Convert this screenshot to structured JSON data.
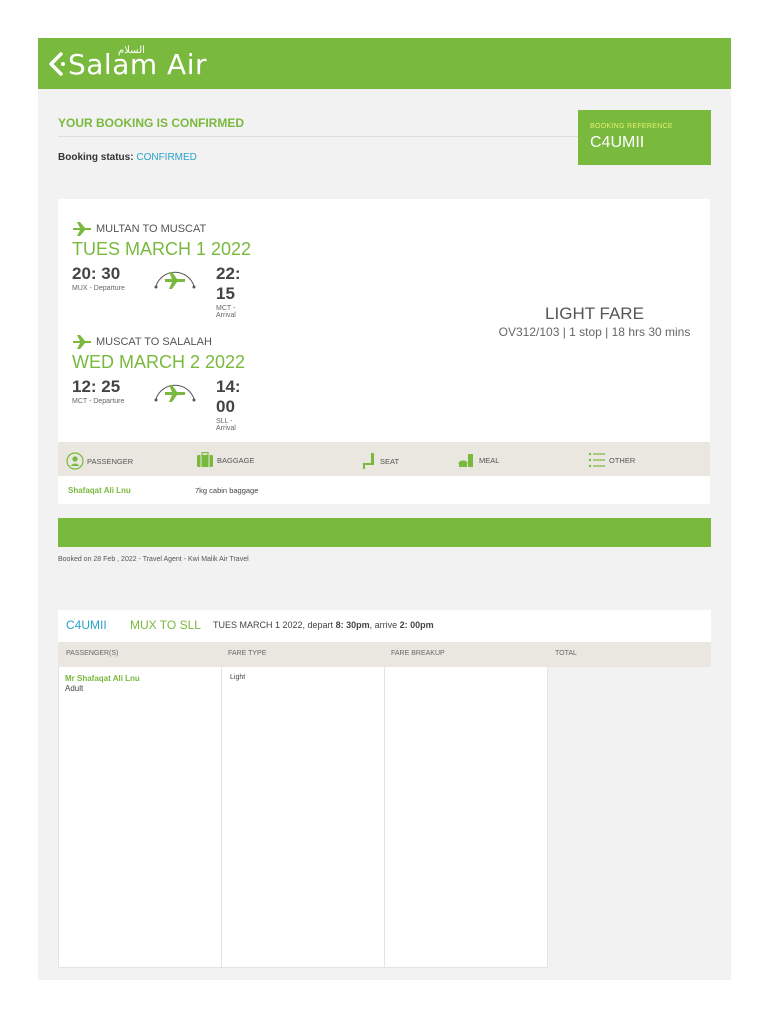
{
  "header": {
    "logo_text": "Salam Air",
    "logo_arabic": "السلام"
  },
  "confirmation": {
    "title": "YOUR BOOKING IS CONFIRMED",
    "status_label": "Booking status:",
    "status_value": "CONFIRMED"
  },
  "reference": {
    "label": "BOOKING REFERENCE",
    "value": "C4UMII"
  },
  "segments": [
    {
      "route": "MULTAN TO MUSCAT",
      "date": "TUES MARCH 1 2022",
      "dep_time": "20: 30",
      "dep_label": "MUX - Departure",
      "arr_time": "22: 15",
      "arr_label": "MCT - Arrival"
    },
    {
      "route": "MUSCAT TO SALALAH",
      "date": "WED MARCH 2 2022",
      "dep_time": "12: 25",
      "dep_label": "MCT - Departure",
      "arr_time": "14: 00",
      "arr_label": "SLL - Arrival"
    }
  ],
  "fare": {
    "title": "LIGHT FARE",
    "details": "OV312/103 | 1 stop | 18 hrs 30 mins"
  },
  "tabs": {
    "passenger": "PASSENGER",
    "baggage": "BAGGAGE",
    "seat": "SEAT",
    "meal": "MEAL",
    "other": "OTHER"
  },
  "passenger_row": {
    "name": "Shafaqat Ali Lnu",
    "baggage": "7kg cabin baggage"
  },
  "booked_on": "Booked on 28 Feb , 2022 - Travel Agent - Kwi Malik Air Travel",
  "summary": {
    "ref": "C4UMII",
    "route": "MUX TO SLL",
    "date_text": "TUES MARCH 1 2022, depart",
    "depart_time": "8: 30pm",
    "arrive_text": ", arrive",
    "arrive_time": "2: 00pm",
    "columns": [
      "PASSENGER(S)",
      "FARE TYPE",
      "FARE BREAKUP",
      "TOTAL"
    ],
    "rows": [
      {
        "name": "Mr Shafaqat Ali Lnu",
        "type": "Adult",
        "fare_type": "Light"
      }
    ]
  },
  "colors": {
    "brand_green": "#79b93e",
    "link_blue": "#2aa3c9",
    "ref_label_yellow": "#e6f06a"
  }
}
